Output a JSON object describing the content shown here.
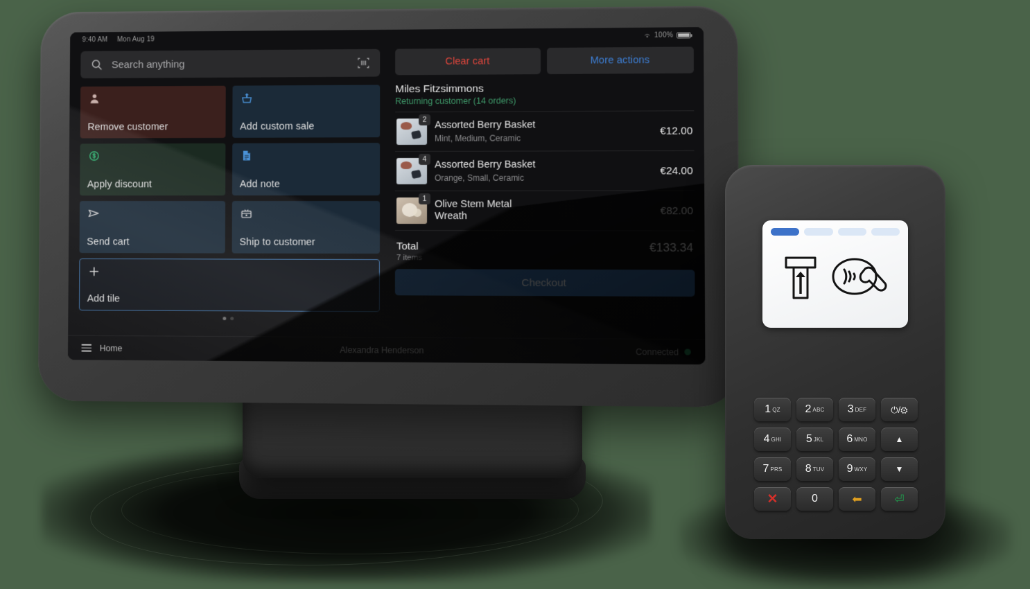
{
  "statusbar": {
    "time": "9:40 AM",
    "date": "Mon Aug 19",
    "battery_pct": "100%",
    "wifi_icon": "wifi-icon",
    "battery_icon": "battery-icon"
  },
  "search": {
    "placeholder": "Search anything",
    "icon": "search-icon",
    "scan_icon": "barcode-scanner-icon"
  },
  "tiles": [
    {
      "label": "Remove customer",
      "icon": "person-icon",
      "style": "tile-red"
    },
    {
      "label": "Add custom sale",
      "icon": "upload-cart-icon",
      "style": "tile-blue"
    },
    {
      "label": "Apply discount",
      "icon": "discount-tag-icon",
      "style": "tile-green"
    },
    {
      "label": "Add note",
      "icon": "note-icon",
      "style": "tile-blue"
    },
    {
      "label": "Send cart",
      "icon": "send-icon",
      "style": "tile-blue"
    },
    {
      "label": "Ship to customer",
      "icon": "shipping-box-icon",
      "style": "tile-blue"
    }
  ],
  "add_tile": {
    "label": "Add tile",
    "icon": "plus-icon"
  },
  "pagination": {
    "dots": 2,
    "active": 0
  },
  "cart": {
    "clear_label": "Clear cart",
    "more_label": "More actions",
    "customer_name": "Miles Fitzsimmons",
    "customer_sub": "Returning customer (14 orders)",
    "items": [
      {
        "qty": "2",
        "title": "Assorted Berry Basket",
        "variant": "Mint, Medium, Ceramic",
        "price": "€12.00",
        "thumb": "berry"
      },
      {
        "qty": "4",
        "title": "Assorted Berry Basket",
        "variant": "Orange, Small, Ceramic",
        "price": "€24.00",
        "thumb": "berry"
      },
      {
        "qty": "1",
        "title": "Olive Stem Metal Wreath",
        "variant": "",
        "price": "€82.00",
        "thumb": "wreath"
      }
    ],
    "total_label": "Total",
    "total_items": "7 items",
    "total_amount": "€133.34",
    "checkout_label": "Checkout"
  },
  "navbar": {
    "menu_icon": "hamburger-menu-icon",
    "home_label": "Home",
    "staff_name": "Alexandra Henderson",
    "status_label": "Connected",
    "status_dot": "green-status-dot"
  },
  "reader": {
    "progress_pills": 4,
    "progress_active": 1,
    "insert_icon": "card-insert-icon",
    "tap_icon": "contactless-tap-icon",
    "keys": [
      {
        "num": "1",
        "sub": "QZ"
      },
      {
        "num": "2",
        "sub": "ABC"
      },
      {
        "num": "3",
        "sub": "DEF"
      },
      {
        "num": "⏻/⚙",
        "sub": "",
        "kind": "power"
      },
      {
        "num": "4",
        "sub": "GHI"
      },
      {
        "num": "5",
        "sub": "JKL"
      },
      {
        "num": "6",
        "sub": "MNO"
      },
      {
        "num": "▲",
        "sub": "",
        "kind": "up"
      },
      {
        "num": "7",
        "sub": "PRS"
      },
      {
        "num": "8",
        "sub": "TUV"
      },
      {
        "num": "9",
        "sub": "WXY"
      },
      {
        "num": "▼",
        "sub": "",
        "kind": "down"
      },
      {
        "num": "✕",
        "sub": "",
        "kind": "cancel"
      },
      {
        "num": "0",
        "sub": ""
      },
      {
        "num": "⬅",
        "sub": "",
        "kind": "back"
      },
      {
        "num": "⏎",
        "sub": "",
        "kind": "enter"
      }
    ]
  },
  "colors": {
    "background": "#4a6349",
    "accent_blue": "#3a6ea8",
    "danger_red": "#e2463c",
    "link_blue": "#3d7fd6",
    "success_green": "#3f9a6a",
    "status_green": "#2fae6f"
  }
}
